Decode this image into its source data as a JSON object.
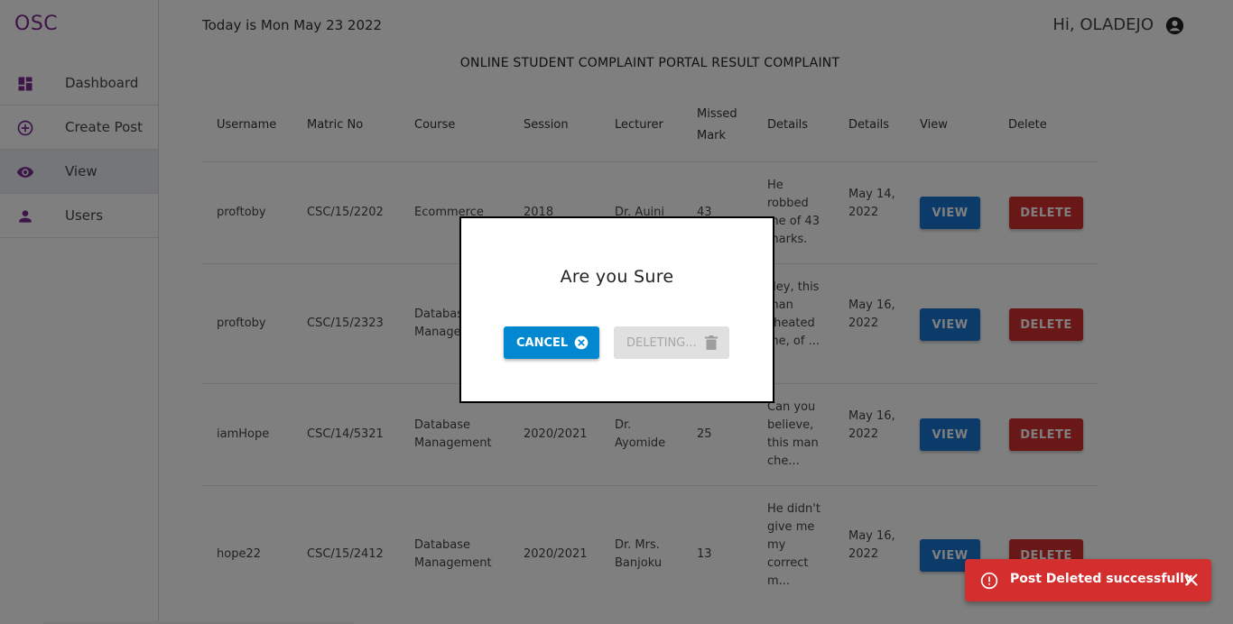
{
  "app": {
    "logo": "OSC"
  },
  "sidebar": {
    "items": [
      {
        "label": "Dashboard",
        "icon": "dashboard-icon"
      },
      {
        "label": "Create Post",
        "icon": "add-circle-icon"
      },
      {
        "label": "View",
        "icon": "eye-icon",
        "active": true
      },
      {
        "label": "Users",
        "icon": "person-icon"
      }
    ]
  },
  "header": {
    "date": "Today is Mon May 23 2022",
    "greeting": "Hi, OLADEJO",
    "title": "ONLINE STUDENT COMPLAINT PORTAL RESULT COMPLAINT"
  },
  "table": {
    "columns": [
      "Username",
      "Matric No",
      "Course",
      "Session",
      "Lecturer",
      "Missed Mark",
      "Details",
      "Details",
      "View",
      "Delete"
    ],
    "view_label": "VIEW",
    "delete_label": "DELETE",
    "rows": [
      {
        "username": "proftoby",
        "matric": "CSC/15/2202",
        "course": "Ecommerce",
        "session": "2018",
        "lecturer": "Dr. Auini",
        "mark": "43",
        "details": "He robbed me of 43 marks.",
        "date": "May 14, 2022"
      },
      {
        "username": "proftoby",
        "matric": "CSC/15/2323",
        "course": "Database Management",
        "session": "",
        "lecturer": "",
        "mark": "",
        "details": "Hey, this man cheated me, of ...",
        "date": "May 16, 2022"
      },
      {
        "username": "iamHope",
        "matric": "CSC/14/5321",
        "course": "Database Management",
        "session": "2020/2021",
        "lecturer": "Dr. Ayomide",
        "mark": "25",
        "details": "Can you believe, this man che...",
        "date": "May 16, 2022"
      },
      {
        "username": "hope22",
        "matric": "CSC/15/2412",
        "course": "Database Management",
        "session": "2020/2021",
        "lecturer": "Dr. Mrs. Banjoku",
        "mark": "13",
        "details": "He didn't give me my correct m...",
        "date": "May 16, 2022"
      }
    ]
  },
  "modal": {
    "title": "Are you Sure",
    "cancel_label": "CANCEL",
    "deleting_label": "DELETING..."
  },
  "toast": {
    "message": "Post Deleted successfully"
  },
  "colors": {
    "brand": "#7b2a91",
    "view": "#1976d2",
    "delete": "#d32f2f",
    "cancel": "#0288d1"
  }
}
